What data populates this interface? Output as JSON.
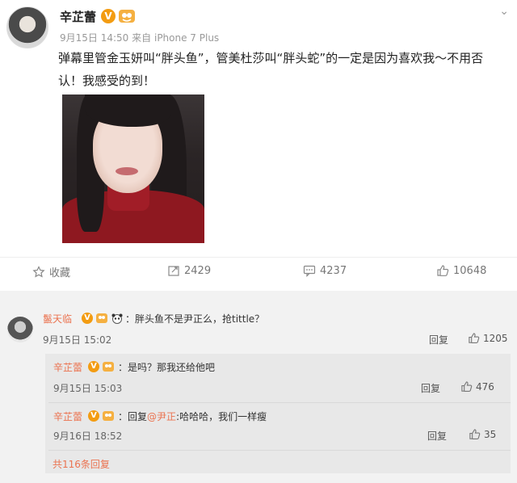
{
  "post": {
    "author": "辛芷蕾",
    "time": "9月15日 14:50",
    "source_prefix": "来自",
    "source": "iPhone 7 Plus",
    "text": "弹幕里管金玉妍叫“胖头鱼”，管美杜莎叫“胖头蛇”的一定是因为喜欢我～不用否认！我感受的到！"
  },
  "actions": {
    "favorite": "收藏",
    "repost": "2429",
    "comment": "4237",
    "like": "10648"
  },
  "comments": [
    {
      "author": "鬣天临",
      "text": "：胖头鱼不是尹正么，抢tittle？",
      "time": "9月15日 15:02",
      "reply": "回复",
      "likes": "1205"
    }
  ],
  "replies": [
    {
      "author": "辛芷蕾",
      "text": "：是吗？那我还给他吧",
      "time": "9月15日 15:03",
      "reply": "回复",
      "likes": "476"
    },
    {
      "author": "辛芷蕾",
      "text_prefix": "：回复",
      "mention": "@尹正",
      "text_suffix": ":哈哈哈，我们一样瘦",
      "time": "9月16日 18:52",
      "reply": "回复",
      "likes": "35"
    }
  ],
  "total_replies": "共116条回复",
  "colors": {
    "accent": "#eb7350",
    "verified": "#f39c12"
  }
}
